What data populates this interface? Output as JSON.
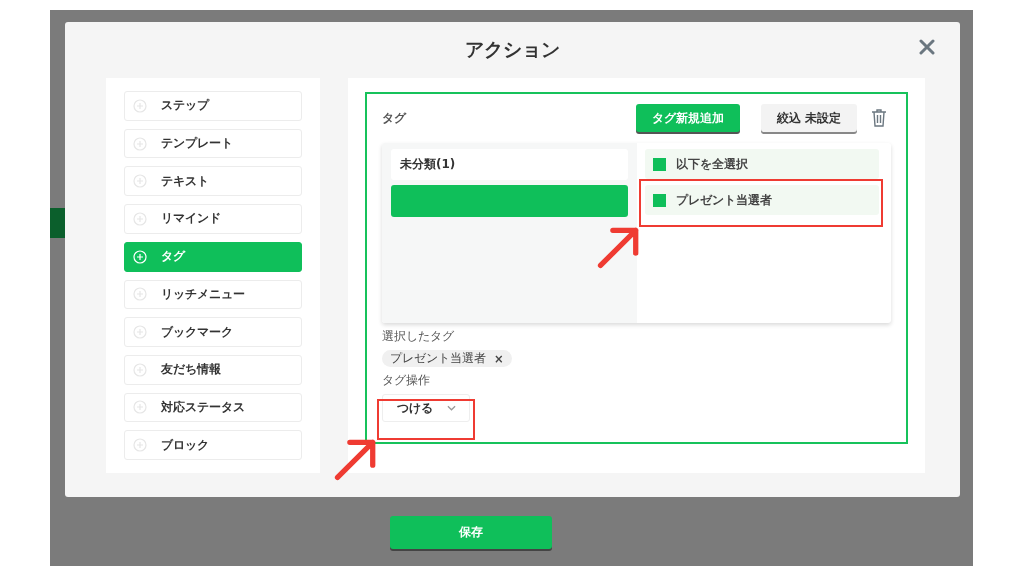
{
  "dialog": {
    "title": "アクション"
  },
  "sidebar": {
    "items": [
      {
        "label": "ステップ",
        "selected": false
      },
      {
        "label": "テンプレート",
        "selected": false
      },
      {
        "label": "テキスト",
        "selected": false
      },
      {
        "label": "リマインド",
        "selected": false
      },
      {
        "label": "タグ",
        "selected": true
      },
      {
        "label": "リッチメニュー",
        "selected": false
      },
      {
        "label": "ブックマーク",
        "selected": false
      },
      {
        "label": "友だち情報",
        "selected": false
      },
      {
        "label": "対応ステータス",
        "selected": false
      },
      {
        "label": "ブロック",
        "selected": false
      }
    ]
  },
  "tag_panel": {
    "title": "タグ",
    "add_button": "タグ新規追加",
    "filter_button": "絞込 未設定",
    "categories": [
      {
        "label": "未分類(1)",
        "selected": false
      },
      {
        "selected": true
      }
    ],
    "select_all": {
      "label": "以下を全選択",
      "checked": true
    },
    "tags": [
      {
        "label": "プレゼント当選者",
        "checked": true
      }
    ],
    "selected_label": "選択したタグ",
    "selected_tags": [
      {
        "label": "プレゼント当選者",
        "remove": "×"
      }
    ],
    "operation_label": "タグ操作",
    "operation": {
      "value": "つける"
    }
  },
  "save_button": "保存"
}
